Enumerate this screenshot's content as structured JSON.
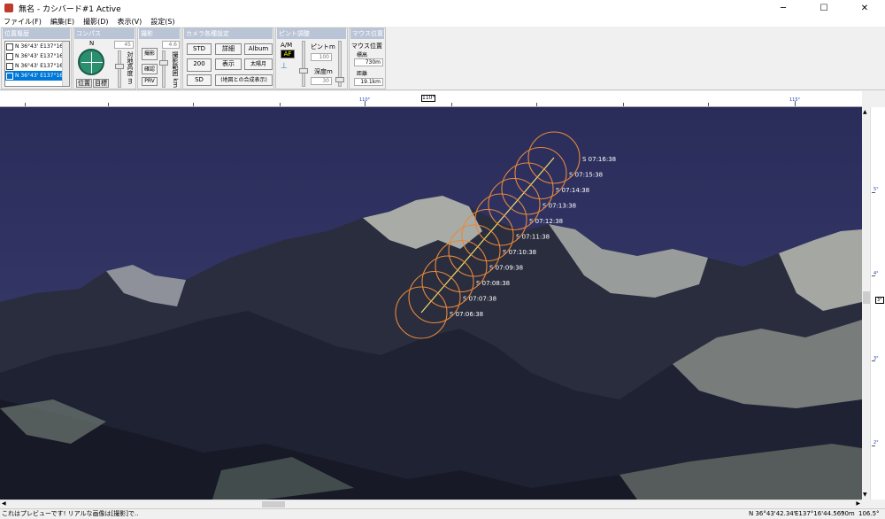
{
  "window": {
    "title": "無名 - カシバード#1 Active",
    "min": "─",
    "max": "☐",
    "close": "✕"
  },
  "menu": [
    "ファイル(F)",
    "編集(E)",
    "撮影(D)",
    "表示(V)",
    "設定(S)"
  ],
  "groups": {
    "history": {
      "title": "位置履歴",
      "items": [
        "N 36°43' E137°16'",
        "N 36°43' E137°16'",
        "N 36°43' E137°16'",
        "N 36°43' E137°16'"
      ]
    },
    "compass": {
      "title": "コンパス",
      "north": "N",
      "btn_pos": "位置",
      "btn_target": "目標",
      "elev_label": "対地高度 m",
      "elev_value": "45"
    },
    "shoot": {
      "title": "撮影",
      "btn_shoot": "撮影",
      "btn_confirm": "確認",
      "btn_prv": "PRV",
      "range_label": "撮影範囲 km",
      "range_value": "4.6"
    },
    "camera": {
      "title": "カメラ各種設定",
      "btn_std": "STD",
      "btn_detail": "詳細",
      "btn_album": "Album",
      "btn_200": "200",
      "btn_display": "表示",
      "btn_sun": "太陽月",
      "btn_sd": "SD",
      "btn_compose": "(地図との合成表示)"
    },
    "focus": {
      "title": "ピント調整",
      "am": "A/M",
      "af": "AF",
      "focus_label": "ピントm",
      "focus_value": "100",
      "depth_label": "深度m",
      "depth_value": "30"
    },
    "mouse": {
      "title": "マウス位置",
      "heading": "マウス位置",
      "elev_label": "標高",
      "elev_value": "730m",
      "dist_label": "距離",
      "dist_value": "19.1km"
    }
  },
  "ruler": {
    "current": "110°",
    "labels": [
      "110°",
      "115°"
    ]
  },
  "vruler": {
    "labels": [
      "5°",
      "4°",
      "3°",
      "2°"
    ],
    "current": "3°"
  },
  "track": {
    "labels": [
      "S 07:06:38",
      "S 07:07:38",
      "S 07:08:38",
      "S 07:09:38",
      "S 07:10:38",
      "S 07:11:38",
      "S 07:12:38",
      "S 07:13:38",
      "S 07:14:38",
      "S 07:15:38",
      "S 07:16:38"
    ],
    "circle_color": "#e8883a",
    "line_color": "#f0e06a"
  },
  "status": {
    "message": "これはプレビューです! リアルな画像は[撮影]で..",
    "lat": "N 36°43'42.34\"",
    "lon": "E137°16'44.56\"",
    "elev": "90m",
    "angle": "106.5°"
  }
}
